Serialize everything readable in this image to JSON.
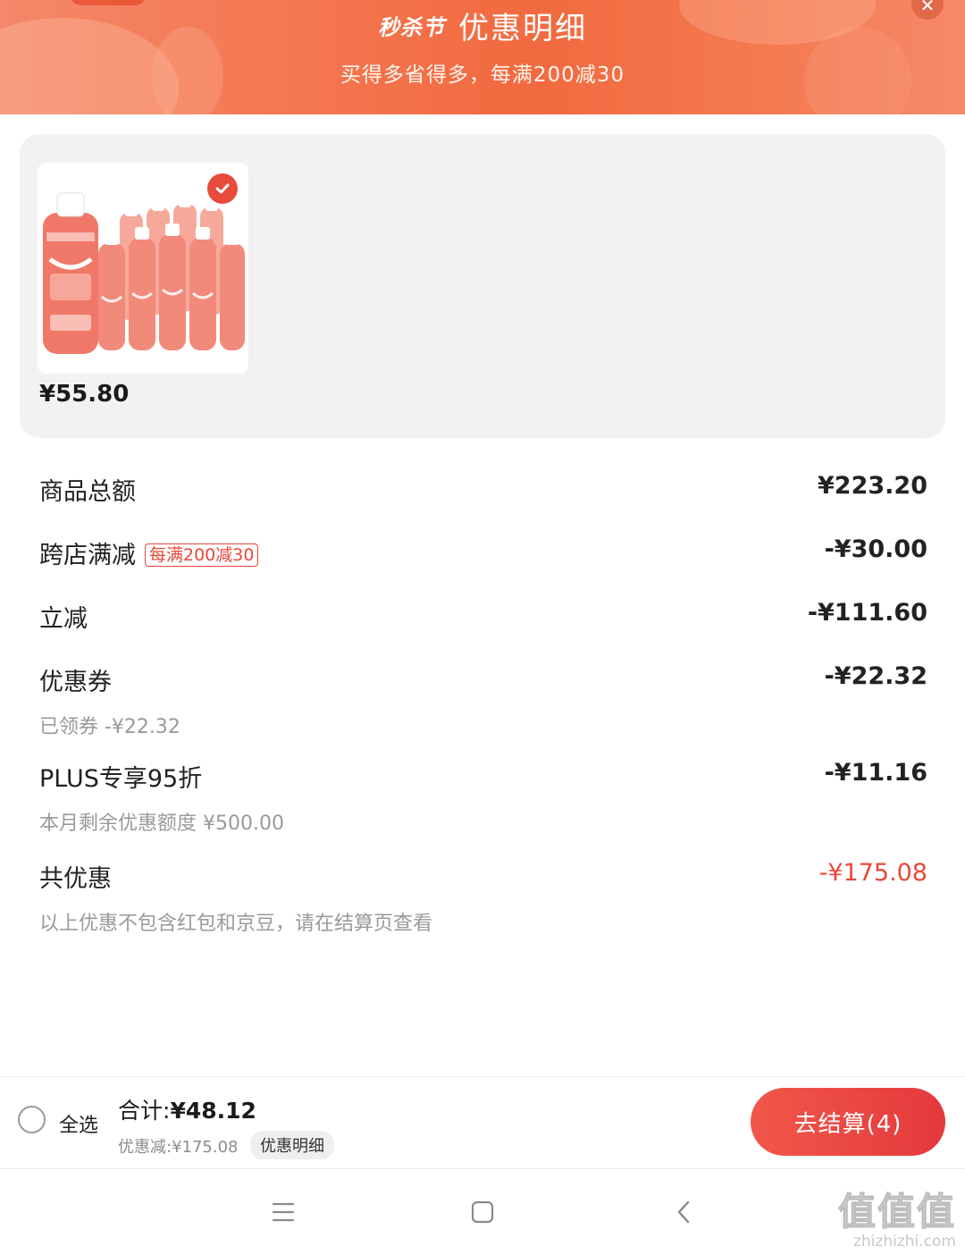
{
  "header": {
    "festival_label": "秒杀节",
    "title": "优惠明细",
    "subtitle": "买得多省得多，每满200减30"
  },
  "product": {
    "price": "¥55.80",
    "selected": true,
    "image_icon": "sparkling-water-bottles-image"
  },
  "summary": {
    "goods_total": {
      "label": "商品总额",
      "value": "¥223.20"
    },
    "cross_store": {
      "label": "跨店满减",
      "tag": "每满200减30",
      "value": "-¥30.00"
    },
    "instant_discount": {
      "label": "立减",
      "value": "-¥111.60"
    },
    "coupon": {
      "label": "优惠券",
      "value": "-¥22.32",
      "sub": "已领券 -¥22.32"
    },
    "plus": {
      "label": "PLUS专享95折",
      "value": "-¥11.16",
      "sub": "本月剩余优惠额度 ¥500.00"
    },
    "total_discount": {
      "label": "共优惠",
      "value": "-¥175.08",
      "sub": "以上优惠不包含红包和京豆，请在结算页查看"
    }
  },
  "bottom_bar": {
    "select_all": "全选",
    "total_label": "合计:",
    "total_value": "¥48.12",
    "discount_line": "优惠减:¥175.08",
    "detail_button": "优惠明细",
    "checkout_button": "去结算(4)"
  },
  "watermark": {
    "big": "值值值",
    "small": "zhizhizhi.com"
  },
  "colors": {
    "accent_red": "#e8483a",
    "banner_orange": "#f26a3f"
  }
}
